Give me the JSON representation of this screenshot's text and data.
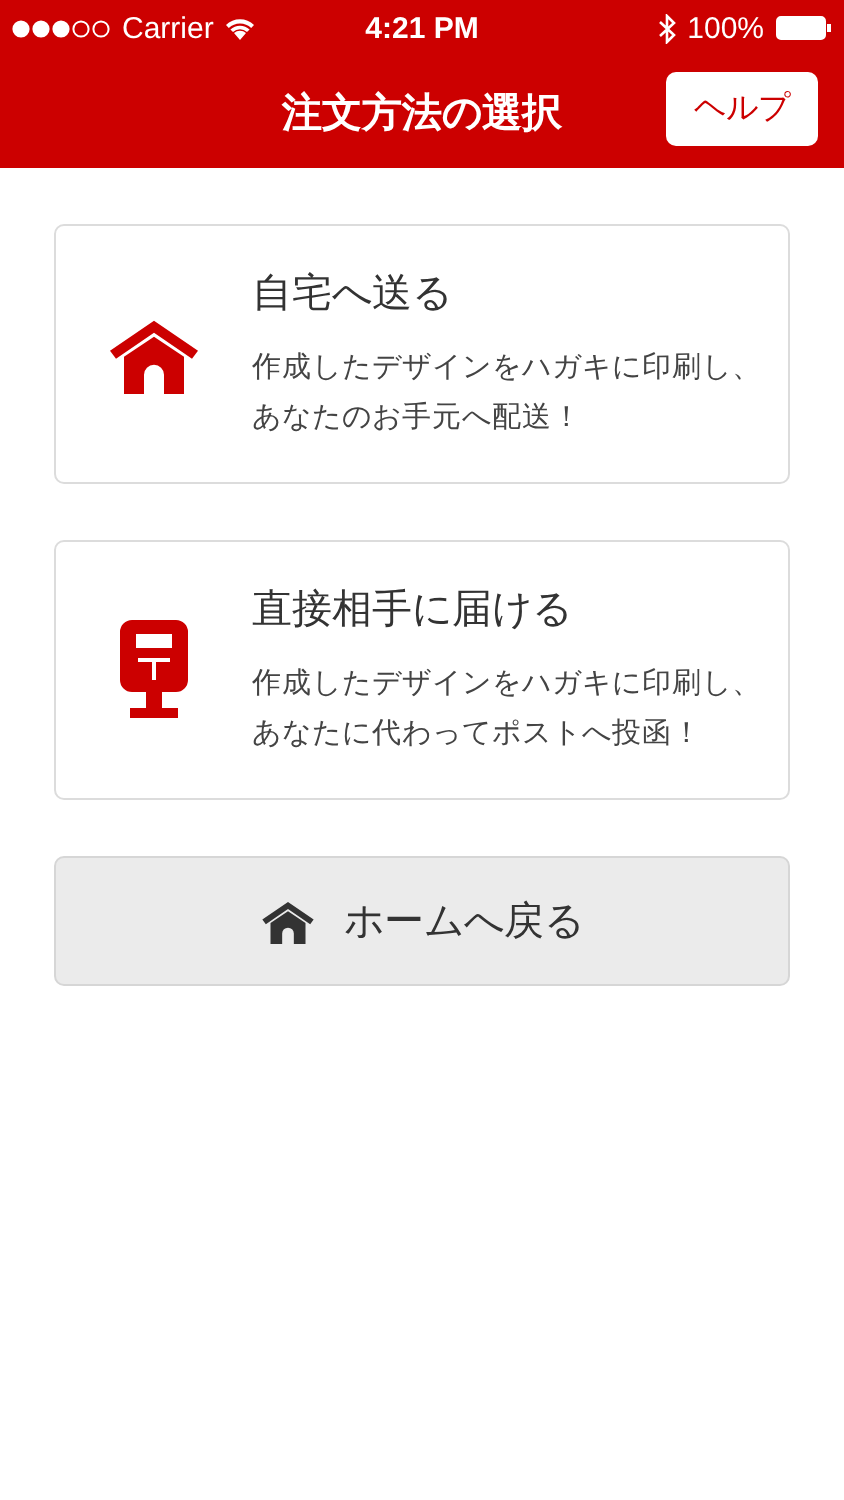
{
  "status_bar": {
    "carrier": "Carrier",
    "time": "4:21 PM",
    "battery": "100%"
  },
  "nav_bar": {
    "title": "注文方法の選択",
    "help_button": "ヘルプ"
  },
  "options": [
    {
      "kind": "home",
      "title": "自宅へ送る",
      "description_lines": [
        "作成したデザインをハガキに印刷し、",
        "あなたのお手元へ配送！"
      ]
    },
    {
      "kind": "postbox",
      "title": "直接相手に届ける",
      "description_lines": [
        "作成したデザインをハガキに印刷し、",
        "あなたに代わってポストへ投函！"
      ]
    }
  ],
  "home_button": "ホームへ戻る"
}
